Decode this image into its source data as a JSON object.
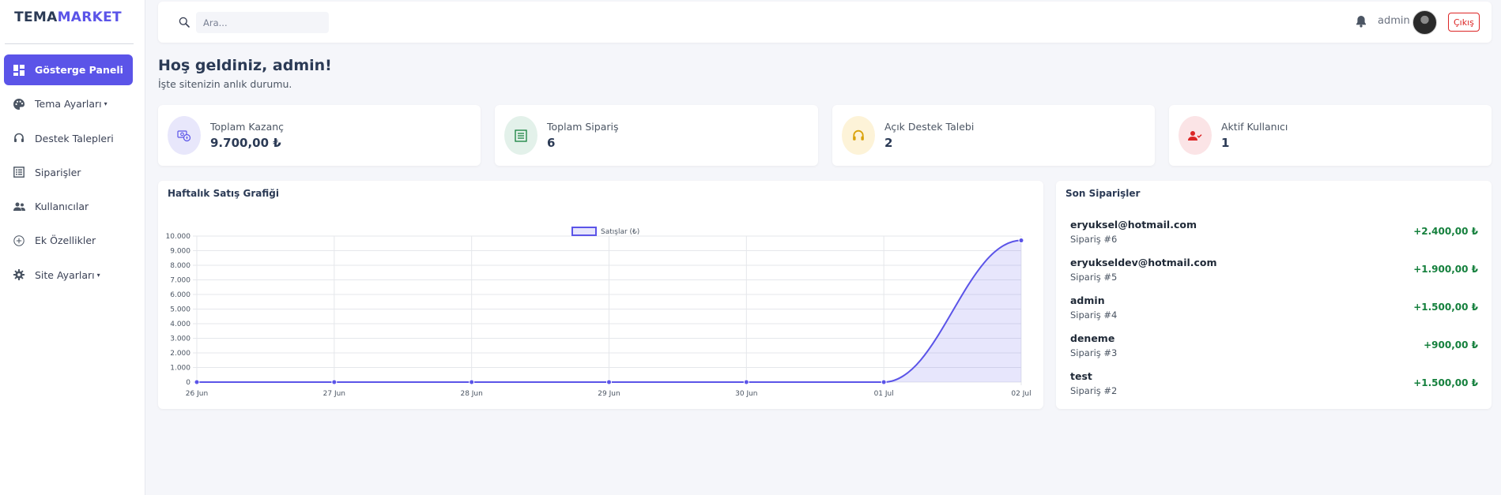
{
  "brand": {
    "part1": "TEMA",
    "part2": "MARKET"
  },
  "sidebar": {
    "items": [
      {
        "label": "Gösterge Paneli",
        "icon": "dashboard-icon",
        "active": true,
        "caret": false
      },
      {
        "label": "Tema Ayarları",
        "icon": "palette-icon",
        "active": false,
        "caret": true
      },
      {
        "label": "Destek Talepleri",
        "icon": "headset-icon",
        "active": false,
        "caret": false
      },
      {
        "label": "Siparişler",
        "icon": "list-icon",
        "active": false,
        "caret": false
      },
      {
        "label": "Kullanıcılar",
        "icon": "users-icon",
        "active": false,
        "caret": false
      },
      {
        "label": "Ek Özellikler",
        "icon": "plus-circle-icon",
        "active": false,
        "caret": false
      },
      {
        "label": "Site Ayarları",
        "icon": "gear-icon",
        "active": false,
        "caret": true
      }
    ]
  },
  "topbar": {
    "search_placeholder": "Ara...",
    "username": "admin",
    "logout_label": "Çıkış"
  },
  "welcome": {
    "title": "Hoş geldiniz, admin!",
    "subtitle": "İşte sitenizin anlık durumu."
  },
  "stats": [
    {
      "label": "Toplam Kazanç",
      "value": "9.700,00 ₺",
      "icon": "money-icon",
      "bg": "#e8e7fb",
      "fg": "#5b54e8"
    },
    {
      "label": "Toplam Sipariş",
      "value": "6",
      "icon": "receipt-icon",
      "bg": "#e3f1ea",
      "fg": "#15803d"
    },
    {
      "label": "Açık Destek Talebi",
      "value": "2",
      "icon": "headset-icon",
      "bg": "#fdf3d8",
      "fg": "#d9a20b"
    },
    {
      "label": "Aktif Kullanıcı",
      "value": "1",
      "icon": "user-check-icon",
      "bg": "#fbe4e6",
      "fg": "#dc2626"
    }
  ],
  "chart": {
    "title": "Haftalık Satış Grafiği"
  },
  "chart_data": {
    "type": "line",
    "x": [
      "26 Jun",
      "27 Jun",
      "28 Jun",
      "29 Jun",
      "30 Jun",
      "01 Jul",
      "02 Jul"
    ],
    "series": [
      {
        "name": "Satışlar (₺)",
        "values": [
          0,
          0,
          0,
          0,
          0,
          0,
          9700
        ],
        "color": "#5b54e8",
        "fill": true
      }
    ],
    "yticks": [
      "0",
      "1.000",
      "2.000",
      "3.000",
      "4.000",
      "5.000",
      "6.000",
      "7.000",
      "8.000",
      "9.000",
      "10.000"
    ],
    "ylim": [
      0,
      10000
    ],
    "grid": true,
    "legend": "top-center"
  },
  "orders": {
    "title": "Son Siparişler",
    "items": [
      {
        "email": "eryuksel@hotmail.com",
        "order": "Sipariş #6",
        "amount": "+2.400,00 ₺"
      },
      {
        "email": "eryukseldev@hotmail.com",
        "order": "Sipariş #5",
        "amount": "+1.900,00 ₺"
      },
      {
        "email": "admin",
        "order": "Sipariş #4",
        "amount": "+1.500,00 ₺"
      },
      {
        "email": "deneme",
        "order": "Sipariş #3",
        "amount": "+900,00 ₺"
      },
      {
        "email": "test",
        "order": "Sipariş #2",
        "amount": "+1.500,00 ₺"
      }
    ]
  }
}
